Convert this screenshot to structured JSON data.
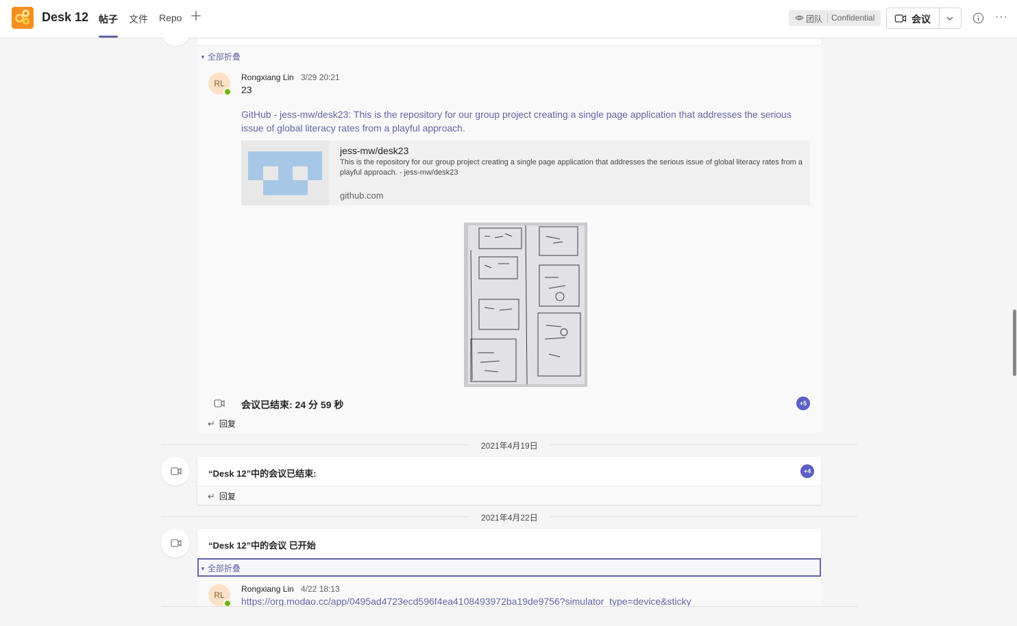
{
  "header": {
    "team_name": "Desk 12",
    "tabs": [
      {
        "label": "帖子",
        "active": true
      },
      {
        "label": "文件",
        "active": false
      },
      {
        "label": "Repo",
        "active": false
      }
    ],
    "add_tab_icon": "plus-icon",
    "visibility_label": "团队",
    "sensitivity_label": "Confidential",
    "meet_label": "会议",
    "accent_color": "#6264a7"
  },
  "thread1": {
    "collapse_label": "全部折叠",
    "reply": {
      "avatar_initials": "RL",
      "author": "Rongxiang Lin",
      "time": "3/29 20:21",
      "text": "23",
      "link_line1": "GitHub - jess-mw/desk23: This is the repository for our group project creating a single page application that addresses the serious",
      "link_line2": "issue of global literacy rates from a playful approach.",
      "preview": {
        "title": "jess-mw/desk23",
        "description": "This is the repository for our group project creating a single page application that addresses the serious issue of global literacy rates from a playful approach. - jess-mw/desk23",
        "domain": "github.com"
      }
    },
    "meeting_ended": "会议已结束: 24 分 59 秒",
    "participants_badge": "+5",
    "reply_label": "回复"
  },
  "date1": "2021年4月19日",
  "thread2": {
    "title": "“Desk 12”中的会议已结束:",
    "participants_badge": "+4",
    "reply_label": "回复"
  },
  "date2": "2021年4月22日",
  "thread3": {
    "title": "“Desk 12”中的会议 已开始",
    "collapse_label": "全部折叠",
    "reply": {
      "avatar_initials": "RL",
      "author": "Rongxiang Lin",
      "time": "4/22 18:13",
      "link": "https://org.modao.cc/app/0495ad4723ecd596f4ea4108493972ba19de9756?simulator_type=device&sticky"
    }
  }
}
